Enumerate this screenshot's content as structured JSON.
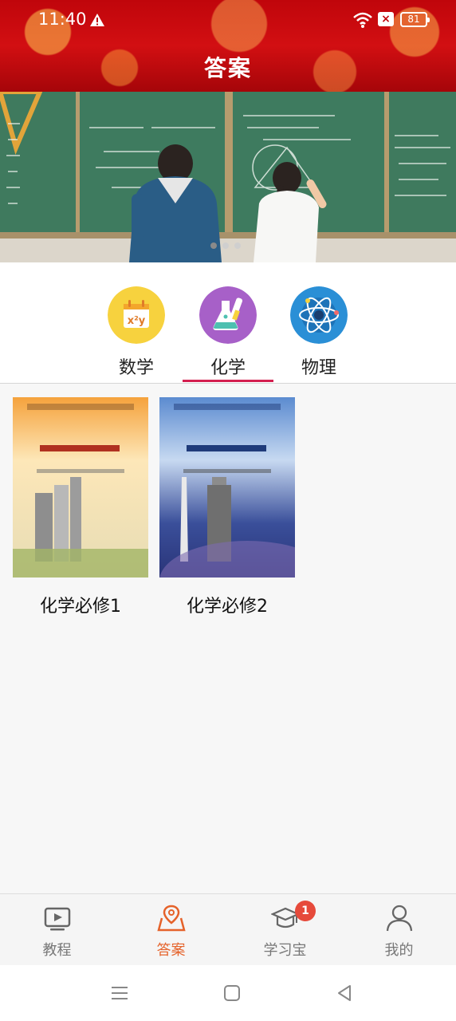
{
  "status_bar": {
    "time": "11:40",
    "battery": "81"
  },
  "header": {
    "title": "答案"
  },
  "banner": {
    "dot_count": 3,
    "active_dot": 0
  },
  "subjects": [
    {
      "label": "数学",
      "icon": "math-icon",
      "color": "#f7d23e",
      "selected": false
    },
    {
      "label": "化学",
      "icon": "flask-icon",
      "color": "#a760c8",
      "selected": true
    },
    {
      "label": "物理",
      "icon": "atom-icon",
      "color": "#2a8fd6",
      "selected": false
    }
  ],
  "books": [
    {
      "label": "化学必修1",
      "cover_title": "化学",
      "volume": "1"
    },
    {
      "label": "化学必修2",
      "cover_title": "化学",
      "volume": "2"
    }
  ],
  "bottom_nav": [
    {
      "label": "教程",
      "icon": "video-tutorial-icon",
      "active": false
    },
    {
      "label": "答案",
      "icon": "location-answer-icon",
      "active": true
    },
    {
      "label": "学习宝",
      "icon": "graduation-cap-icon",
      "active": false,
      "badge": "1"
    },
    {
      "label": "我的",
      "icon": "user-profile-icon",
      "active": false
    }
  ],
  "colors": {
    "accent": "#e5622a",
    "tab_underline": "#d41f4f",
    "header_red": "#c0050b"
  }
}
